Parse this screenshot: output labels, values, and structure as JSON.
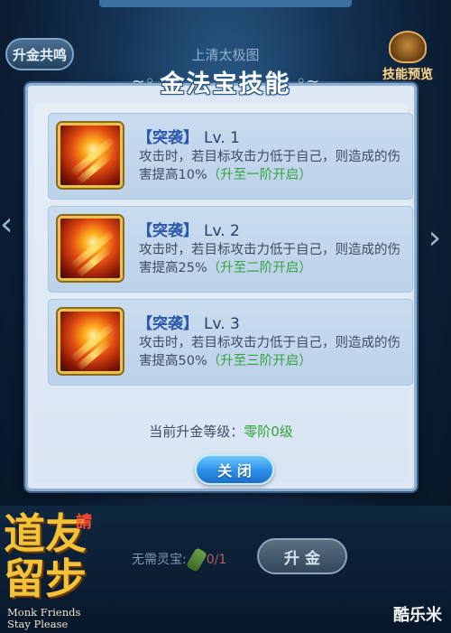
{
  "header": {
    "left_button": "升金共鸣",
    "subtitle": "上清太极图",
    "preview_button": "技能预览"
  },
  "dialog": {
    "title": "金法宝技能",
    "skills": [
      {
        "name": "【突袭】",
        "level": "Lv. 1",
        "desc": "攻击时，若目标攻击力低于自己，则造成的伤害提高10%",
        "unlock": "（升至一阶开启）"
      },
      {
        "name": "【突袭】",
        "level": "Lv. 2",
        "desc": "攻击时，若目标攻击力低于自己，则造成的伤害提高25%",
        "unlock": "（升至二阶开启）"
      },
      {
        "name": "【突袭】",
        "level": "Lv. 3",
        "desc": "攻击时，若目标攻击力低于自己，则造成的伤害提高50%",
        "unlock": "（升至三阶开启）"
      }
    ],
    "current_level_label": "当前升金等级：",
    "current_level_value": "零阶0级",
    "close_button": "关 闭"
  },
  "bottom": {
    "slot_label": "无需灵宝:",
    "slot_count": "0/1",
    "upgrade_button": "升 金"
  },
  "logo": {
    "chars": "道友留步",
    "badge": "請",
    "english_line1": "Monk Friends",
    "english_line2": "Stay Please"
  },
  "watermark": "酷乐米"
}
